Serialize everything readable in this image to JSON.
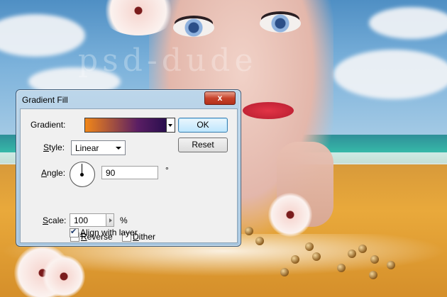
{
  "background": {
    "watermark": "psd-dude"
  },
  "dialog": {
    "title": "Gradient Fill",
    "close_label": "x",
    "gradient": {
      "label": "Gradient:",
      "colors": [
        "#f28718",
        "#5a1e64",
        "#2a0f4e"
      ]
    },
    "style": {
      "label_mnemonic": "S",
      "label_rest": "tyle:",
      "value": "Linear"
    },
    "angle": {
      "label_mnemonic": "A",
      "label_rest": "ngle:",
      "value": "90",
      "unit": "°"
    },
    "scale": {
      "label_mnemonic": "S",
      "label_rest": "cale:",
      "value": "100",
      "unit": "%"
    },
    "reverse": {
      "label_mnemonic": "R",
      "label_rest": "everse",
      "checked": true
    },
    "dither": {
      "label_mnemonic": "D",
      "label_rest": "ither",
      "checked": false
    },
    "align": {
      "label_mnemonic": "A",
      "label_rest": "lign with layer",
      "checked": true
    },
    "ok_label": "OK",
    "reset_label": "Reset"
  }
}
